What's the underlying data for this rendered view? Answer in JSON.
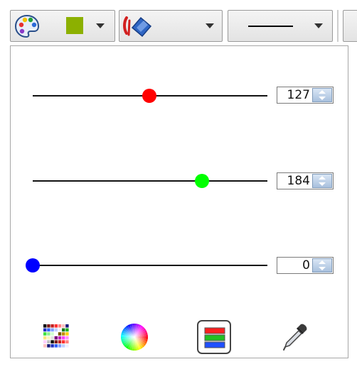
{
  "toolbar": {
    "palette_icon": "palette-icon",
    "fill_color": "#8cb000",
    "fill_caret_icon": "chevron-down-icon",
    "paint_icon": "paint-bucket-icon",
    "line_style": "solid"
  },
  "sliders": [
    {
      "name": "red",
      "value": "127",
      "level": 0.498,
      "knob_color": "#ff0000"
    },
    {
      "name": "green",
      "value": "184",
      "level": 0.722,
      "knob_color": "#00ff00"
    },
    {
      "name": "blue",
      "value": "0",
      "level": 0.0,
      "knob_color": "#0000ff"
    }
  ],
  "modes": [
    {
      "icon": "color-grid-icon",
      "active": false
    },
    {
      "icon": "color-wheel-icon",
      "active": false
    },
    {
      "icon": "rgb-sliders-icon",
      "active": true
    },
    {
      "icon": "eyedropper-icon",
      "active": false
    }
  ]
}
